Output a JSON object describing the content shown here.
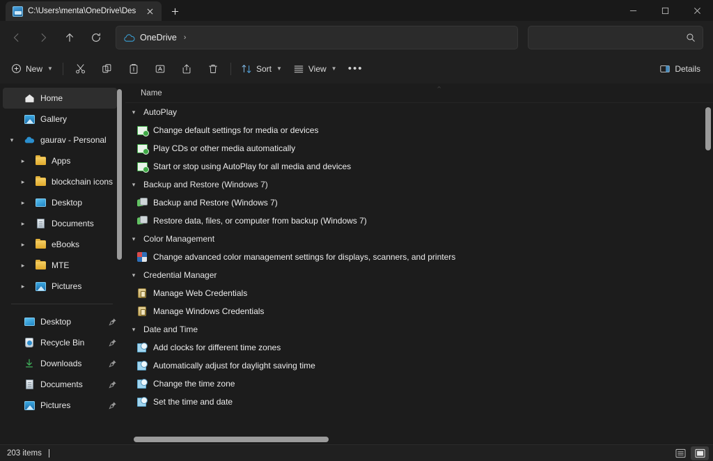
{
  "window": {
    "tab_title": "C:\\Users\\menta\\OneDrive\\Des",
    "new_tab_label": "+",
    "minimize_label": "Minimize",
    "maximize_label": "Maximize",
    "close_label": "Close"
  },
  "addressbar": {
    "back_label": "Back",
    "forward_label": "Forward",
    "up_label": "Up",
    "refresh_label": "Refresh",
    "crumb_label": "OneDrive",
    "crumb_separator": "›",
    "search_placeholder": "",
    "search_value": ""
  },
  "toolbar": {
    "new_label": "New",
    "cut_label": "Cut",
    "copy_label": "Copy",
    "paste_label": "Paste",
    "rename_label": "Rename",
    "share_label": "Share",
    "delete_label": "Delete",
    "sort_label": "Sort",
    "view_label": "View",
    "more_label": "•••",
    "details_label": "Details"
  },
  "sidebar": {
    "items": [
      {
        "label": "Home",
        "icon": "home-icon",
        "expandable": false,
        "selected": true,
        "indent": 0,
        "pinned": false
      },
      {
        "label": "Gallery",
        "icon": "gallery-icon",
        "expandable": false,
        "selected": false,
        "indent": 0,
        "pinned": false
      },
      {
        "label": "gaurav - Personal",
        "icon": "onedrive-icon",
        "expandable": true,
        "expanded": true,
        "selected": false,
        "indent": 0,
        "pinned": false
      },
      {
        "label": "Apps",
        "icon": "folder-icon",
        "expandable": true,
        "expanded": false,
        "selected": false,
        "indent": 1,
        "pinned": false
      },
      {
        "label": "blockchain icons",
        "icon": "folder-icon",
        "expandable": true,
        "expanded": false,
        "selected": false,
        "indent": 1,
        "pinned": false
      },
      {
        "label": "Desktop",
        "icon": "desktop-icon",
        "expandable": true,
        "expanded": false,
        "selected": false,
        "indent": 1,
        "pinned": false
      },
      {
        "label": "Documents",
        "icon": "documents-icon",
        "expandable": true,
        "expanded": false,
        "selected": false,
        "indent": 1,
        "pinned": false
      },
      {
        "label": "eBooks",
        "icon": "folder-icon",
        "expandable": true,
        "expanded": false,
        "selected": false,
        "indent": 1,
        "pinned": false
      },
      {
        "label": "MTE",
        "icon": "folder-icon",
        "expandable": true,
        "expanded": false,
        "selected": false,
        "indent": 1,
        "pinned": false
      },
      {
        "label": "Pictures",
        "icon": "pictures-icon",
        "expandable": true,
        "expanded": false,
        "selected": false,
        "indent": 1,
        "pinned": false
      }
    ],
    "pinned_items": [
      {
        "label": "Desktop",
        "icon": "desktop-icon",
        "pinned": true
      },
      {
        "label": "Recycle Bin",
        "icon": "recycle-bin-icon",
        "pinned": true
      },
      {
        "label": "Downloads",
        "icon": "downloads-icon",
        "pinned": true
      },
      {
        "label": "Documents",
        "icon": "documents-icon",
        "pinned": true
      },
      {
        "label": "Pictures",
        "icon": "pictures-icon",
        "pinned": true
      }
    ]
  },
  "content": {
    "column_header": "Name",
    "sort_caret": "⌃",
    "groups": [
      {
        "name": "AutoPlay",
        "expanded": true,
        "icon": "autoplay-icon",
        "items": [
          "Change default settings for media or devices",
          "Play CDs or other media automatically",
          "Start or stop using AutoPlay for all media and devices"
        ]
      },
      {
        "name": "Backup and Restore (Windows 7)",
        "expanded": true,
        "icon": "backup-icon",
        "items": [
          "Backup and Restore (Windows 7)",
          "Restore data, files, or computer from backup (Windows 7)"
        ]
      },
      {
        "name": "Color Management",
        "expanded": true,
        "icon": "color-management-icon",
        "items": [
          "Change advanced color management settings for displays, scanners, and printers"
        ]
      },
      {
        "name": "Credential Manager",
        "expanded": true,
        "icon": "credential-icon",
        "items": [
          "Manage Web Credentials",
          "Manage Windows Credentials"
        ]
      },
      {
        "name": "Date and Time",
        "expanded": true,
        "icon": "clock-icon",
        "items": [
          "Add clocks for different time zones",
          "Automatically adjust for daylight saving time",
          "Change the time zone",
          "Set the time and date"
        ]
      }
    ]
  },
  "statusbar": {
    "item_count": "203 items",
    "list_view_label": "List view",
    "details_view_label": "Details view"
  },
  "colors": {
    "window_bg": "#202020",
    "content_bg": "#1c1c1c",
    "titlebar_bg": "#191919",
    "tab_active_bg": "#2b2b2b",
    "accent_blue": "#3a9fd4",
    "text_primary": "#ececec",
    "text_secondary": "#b0b0b0",
    "scrollbar": "#9b9b9b",
    "selected_row": "#2e2e2e"
  }
}
